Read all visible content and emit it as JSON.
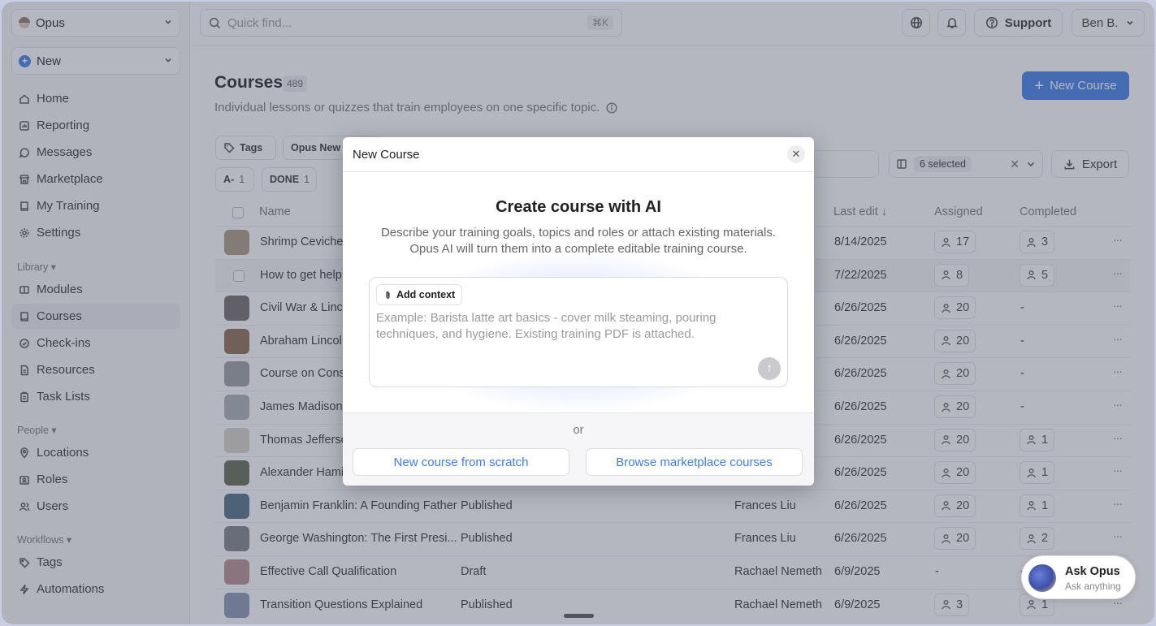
{
  "sidebar": {
    "org": "Opus",
    "new_label": "New",
    "main_items": [
      "Home",
      "Reporting",
      "Messages",
      "Marketplace",
      "My Training",
      "Settings"
    ],
    "library_label": "Library ▾",
    "library_items": [
      "Modules",
      "Courses",
      "Check-ins",
      "Resources",
      "Task Lists"
    ],
    "people_label": "People ▾",
    "people_items": [
      "Locations",
      "Roles",
      "Users"
    ],
    "workflows_label": "Workflows ▾",
    "workflows_items": [
      "Tags",
      "Automations"
    ]
  },
  "topbar": {
    "search_placeholder": "Quick find...",
    "shortcut": "⌘K",
    "support": "Support",
    "user": "Ben B."
  },
  "page": {
    "title": "Courses",
    "count": "489",
    "description": "Individual lessons or quizzes that train employees on one specific topic.",
    "new_course": "New Course"
  },
  "filters": {
    "tags": "Tags",
    "chip2": "Opus New H",
    "chip_a": "A-",
    "chip_a_count": "1",
    "chip_done": "DONE",
    "chip_done_count": "1",
    "columns_selected": "6 selected",
    "export": "Export"
  },
  "table": {
    "headers": {
      "name": "Name",
      "last_edit": "Last edit ↓",
      "assigned": "Assigned",
      "completed": "Completed"
    },
    "rows": [
      {
        "name": "Shrimp Ceviche",
        "status": "",
        "owner": "",
        "last_edit": "8/14/2025",
        "assigned": "17",
        "completed": "3",
        "thumb": "#a89a7e"
      },
      {
        "name": "How to get help",
        "status": "",
        "owner": "",
        "last_edit": "7/22/2025",
        "assigned": "8",
        "completed": "5",
        "thumb": ""
      },
      {
        "name": "Civil War & Linco",
        "status": "",
        "owner": "",
        "last_edit": "6/26/2025",
        "assigned": "20",
        "completed": "-",
        "thumb": "#6f6a64"
      },
      {
        "name": "Abraham Lincol",
        "status": "",
        "owner": "",
        "last_edit": "6/26/2025",
        "assigned": "20",
        "completed": "-",
        "thumb": "#8b6a4c"
      },
      {
        "name": "Course on Consi",
        "status": "",
        "owner": "",
        "last_edit": "6/26/2025",
        "assigned": "20",
        "completed": "-",
        "thumb": "#9a9d9f"
      },
      {
        "name": "James Madison:",
        "status": "",
        "owner": "",
        "last_edit": "6/26/2025",
        "assigned": "20",
        "completed": "-",
        "thumb": "#a7b0b5"
      },
      {
        "name": "Thomas Jefferso",
        "status": "",
        "owner": "",
        "last_edit": "6/26/2025",
        "assigned": "20",
        "completed": "1",
        "thumb": "#d6d0c7"
      },
      {
        "name": "Alexander Hamil",
        "status": "",
        "owner": "",
        "last_edit": "6/26/2025",
        "assigned": "20",
        "completed": "1",
        "thumb": "#5f6650"
      },
      {
        "name": "Benjamin Franklin: A Founding Father",
        "status": "Published",
        "owner": "Frances Liu",
        "last_edit": "6/26/2025",
        "assigned": "20",
        "completed": "1",
        "thumb": "#4f6d82"
      },
      {
        "name": "George Washington: The First Presi...",
        "status": "Published",
        "owner": "Frances Liu",
        "last_edit": "6/26/2025",
        "assigned": "20",
        "completed": "2",
        "thumb": "#7c7f86"
      },
      {
        "name": "Effective Call Qualification",
        "status": "Draft",
        "owner": "Rachael Nemeth",
        "last_edit": "6/9/2025",
        "assigned": "-",
        "completed": "-",
        "thumb": "#b58d8d"
      },
      {
        "name": "Transition Questions Explained",
        "status": "Published",
        "owner": "Rachael Nemeth",
        "last_edit": "6/9/2025",
        "assigned": "3",
        "completed": "1",
        "thumb": "#8794b3"
      }
    ]
  },
  "modal": {
    "title": "New Course",
    "heading": "Create course with AI",
    "desc_line1": "Describe your training goals, topics and roles or attach existing materials.",
    "desc_line2": "Opus AI will turn them into a complete editable training course.",
    "add_context": "Add context",
    "placeholder": "Example: Barista latte art basics - cover milk steaming, pouring techniques, and hygiene. Existing training PDF is attached.",
    "or": "or",
    "scratch": "New course from scratch",
    "browse": "Browse marketplace courses"
  },
  "ask": {
    "title": "Ask Opus",
    "subtitle": "Ask anything"
  },
  "colors": {
    "accent": "#3e7ee8",
    "overlay": "#4e5368"
  }
}
